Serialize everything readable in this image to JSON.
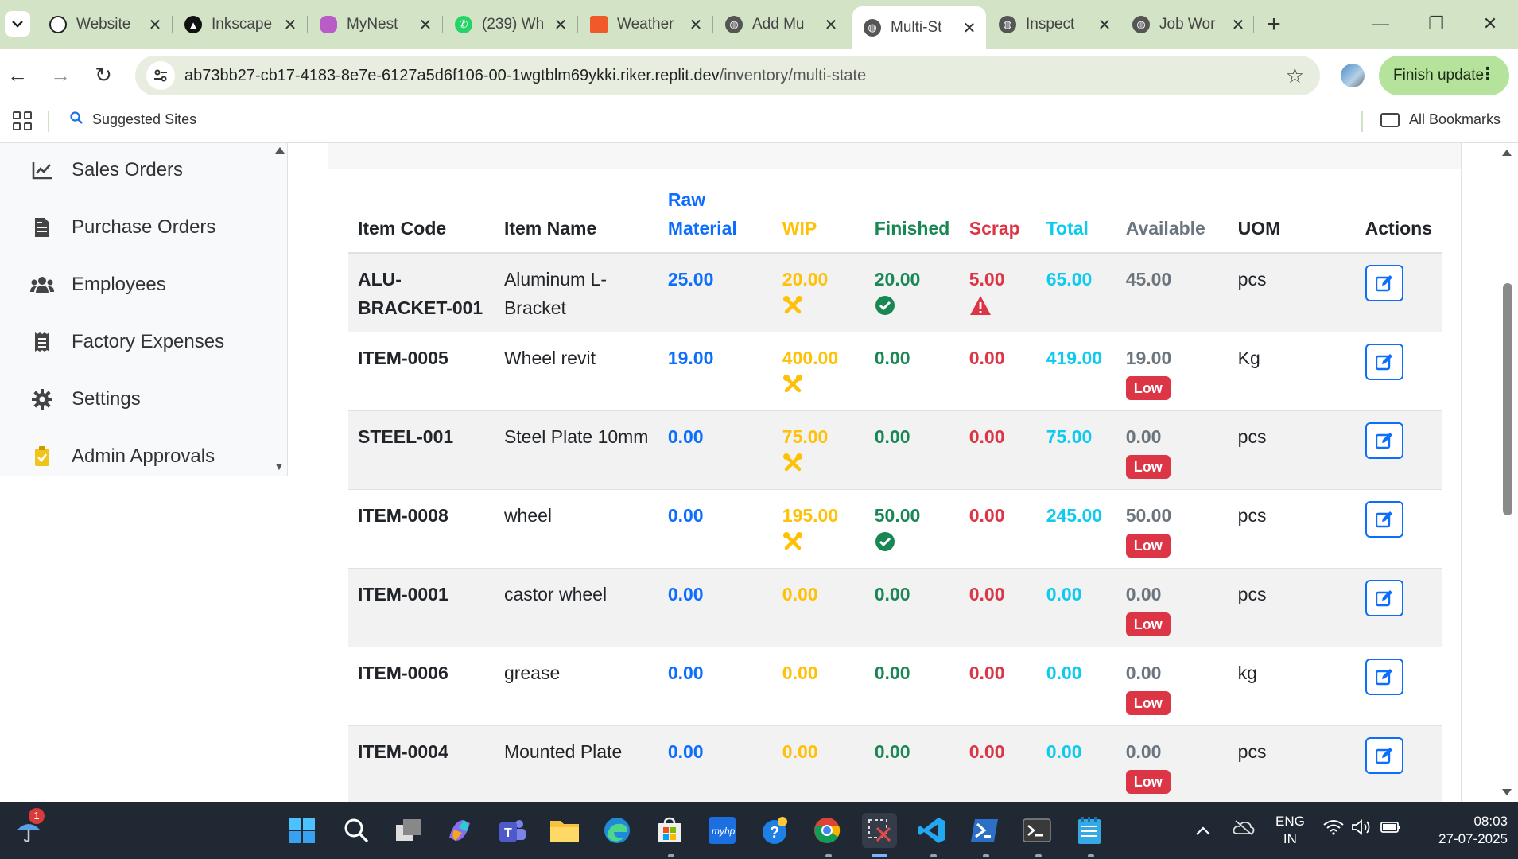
{
  "browser": {
    "tabs": [
      {
        "title": "Website",
        "icon": "openai-icon",
        "color": "#222222"
      },
      {
        "title": "Inkscape",
        "icon": "inkscape-icon",
        "color": "#111111"
      },
      {
        "title": "MyNest",
        "icon": "mynest-icon",
        "color": "#b85cc8"
      },
      {
        "title": "(239) Wh",
        "icon": "whatsapp-icon",
        "color": "#25d366"
      },
      {
        "title": "Weather",
        "icon": "weather-icon",
        "color": "#f05a28"
      },
      {
        "title": "Add Mu",
        "icon": "globe-icon",
        "color": "#555555"
      },
      {
        "title": "Multi-St",
        "icon": "globe-icon",
        "color": "#555555"
      },
      {
        "title": "Inspect",
        "icon": "globe-icon",
        "color": "#555555"
      },
      {
        "title": "Job Wor",
        "icon": "globe-icon",
        "color": "#555555"
      }
    ],
    "url_host": "ab73bb27-cb17-4183-8e7e-6127a5d6f106-00-1wgtblm69ykki.riker.replit.dev",
    "url_path": "/inventory/multi-state",
    "finish_update": "Finish update",
    "suggested_sites": "Suggested Sites",
    "all_bookmarks": "All Bookmarks"
  },
  "sidebar": {
    "items": [
      {
        "label": "Sales Orders",
        "icon": "chart-line-icon"
      },
      {
        "label": "Purchase Orders",
        "icon": "file-invoice-icon"
      },
      {
        "label": "Employees",
        "icon": "users-icon"
      },
      {
        "label": "Factory Expenses",
        "icon": "receipt-icon"
      },
      {
        "label": "Settings",
        "icon": "gear-icon"
      },
      {
        "label": "Admin Approvals",
        "icon": "clipboard-check-icon"
      }
    ]
  },
  "table": {
    "headers": {
      "code": "Item Code",
      "name": "Item Name",
      "raw_line1": "Raw",
      "raw_line2": "Material",
      "wip": "WIP",
      "finished": "Finished",
      "scrap": "Scrap",
      "total": "Total",
      "available": "Available",
      "uom": "UOM",
      "actions": "Actions"
    },
    "low_label": "Low",
    "rows": [
      {
        "code": "ALU-BRACKET-001",
        "name": "Aluminum L-Bracket",
        "raw": "25.00",
        "wip": "20.00",
        "finished": "20.00",
        "scrap": "5.00",
        "total": "65.00",
        "available": "45.00",
        "uom": "pcs"
      },
      {
        "code": "ITEM-0005",
        "name": "Wheel revit",
        "raw": "19.00",
        "wip": "400.00",
        "finished": "0.00",
        "scrap": "0.00",
        "total": "419.00",
        "available": "19.00",
        "uom": "Kg"
      },
      {
        "code": "STEEL-001",
        "name": "Steel Plate 10mm",
        "raw": "0.00",
        "wip": "75.00",
        "finished": "0.00",
        "scrap": "0.00",
        "total": "75.00",
        "available": "0.00",
        "uom": "pcs"
      },
      {
        "code": "ITEM-0008",
        "name": "wheel",
        "raw": "0.00",
        "wip": "195.00",
        "finished": "50.00",
        "scrap": "0.00",
        "total": "245.00",
        "available": "50.00",
        "uom": "pcs"
      },
      {
        "code": "ITEM-0001",
        "name": "castor wheel",
        "raw": "0.00",
        "wip": "0.00",
        "finished": "0.00",
        "scrap": "0.00",
        "total": "0.00",
        "available": "0.00",
        "uom": "pcs"
      },
      {
        "code": "ITEM-0006",
        "name": "grease",
        "raw": "0.00",
        "wip": "0.00",
        "finished": "0.00",
        "scrap": "0.00",
        "total": "0.00",
        "available": "0.00",
        "uom": "kg"
      },
      {
        "code": "ITEM-0004",
        "name": "Mounted Plate",
        "raw": "0.00",
        "wip": "0.00",
        "finished": "0.00",
        "scrap": "0.00",
        "total": "0.00",
        "available": "0.00",
        "uom": "pcs"
      }
    ]
  },
  "taskbar": {
    "notification_count": "1",
    "lang_line1": "ENG",
    "lang_line2": "IN",
    "time": "08:03",
    "date": "27-07-2025"
  },
  "colors": {
    "raw": "#0d6efd",
    "wip": "#ffc107",
    "finished": "#198754",
    "scrap": "#dc3545",
    "total": "#0dcaf0",
    "available": "#6c757d"
  }
}
